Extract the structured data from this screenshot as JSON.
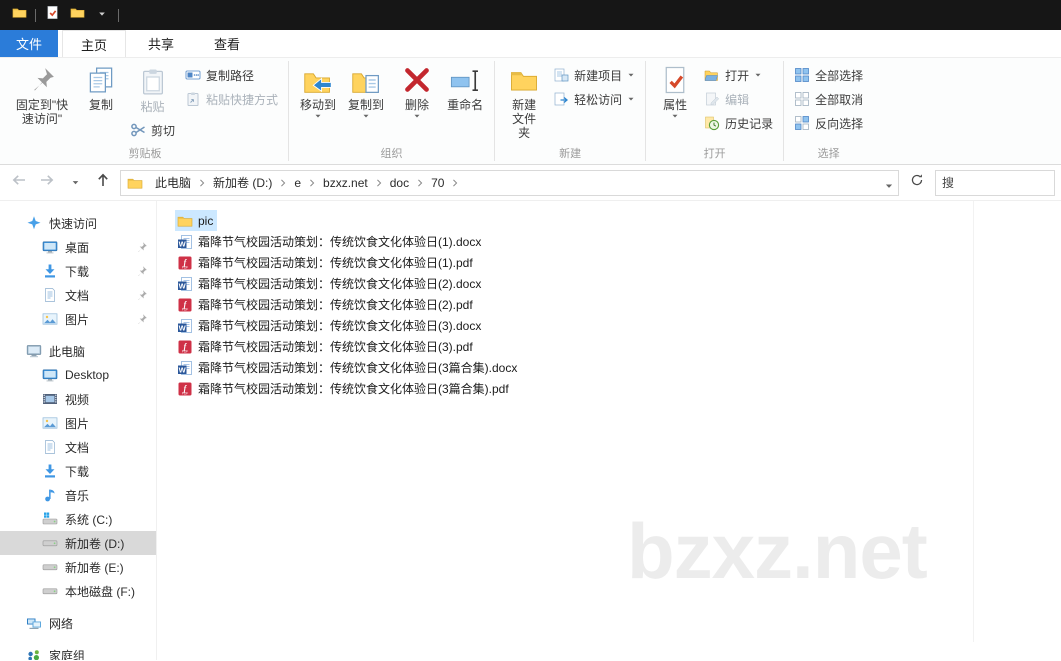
{
  "titlebar": {
    "qat": [
      {
        "icon": "folder"
      },
      {
        "icon": "check-doc"
      },
      {
        "icon": "folder"
      }
    ]
  },
  "tabs": {
    "file": "文件",
    "items": [
      "主页",
      "共享",
      "查看"
    ],
    "active": "主页"
  },
  "ribbon": {
    "clipboard": {
      "pin": "固定到\"快速访问\"",
      "copy": "复制",
      "paste": "粘贴",
      "cut": "剪切",
      "copy_path": "复制路径",
      "paste_shortcut": "粘贴快捷方式",
      "label": "剪贴板"
    },
    "organize": {
      "move_to": "移动到",
      "copy_to": "复制到",
      "delete": "删除",
      "rename": "重命名",
      "label": "组织"
    },
    "new": {
      "new_folder": "新建文件夹",
      "new_item": "新建项目",
      "easy_access": "轻松访问",
      "label": "新建"
    },
    "open": {
      "properties": "属性",
      "open": "打开",
      "edit": "编辑",
      "history": "历史记录",
      "label": "打开"
    },
    "select": {
      "select_all": "全部选择",
      "select_none": "全部取消",
      "invert": "反向选择",
      "label": "选择"
    }
  },
  "addressbar": {
    "breadcrumb": [
      "此电脑",
      "新加卷 (D:)",
      "e",
      "bzxz.net",
      "doc",
      "70"
    ],
    "search_text": "搜"
  },
  "sidebar": {
    "sections": [
      {
        "label": "快速访问",
        "icon": "star",
        "items": [
          {
            "label": "桌面",
            "icon": "desktop",
            "pinned": true
          },
          {
            "label": "下载",
            "icon": "download",
            "pinned": true
          },
          {
            "label": "文档",
            "icon": "document",
            "pinned": true
          },
          {
            "label": "图片",
            "icon": "picture",
            "pinned": true
          }
        ]
      },
      {
        "label": "此电脑",
        "icon": "computer",
        "gap": true,
        "items": [
          {
            "label": "Desktop",
            "icon": "desktop"
          },
          {
            "label": "视频",
            "icon": "video"
          },
          {
            "label": "图片",
            "icon": "picture"
          },
          {
            "label": "文档",
            "icon": "document"
          },
          {
            "label": "下载",
            "icon": "download"
          },
          {
            "label": "音乐",
            "icon": "music"
          },
          {
            "label": "系统 (C:)",
            "icon": "drive-sys"
          },
          {
            "label": "新加卷 (D:)",
            "icon": "drive",
            "selected": true
          },
          {
            "label": "新加卷 (E:)",
            "icon": "drive"
          },
          {
            "label": "本地磁盘 (F:)",
            "icon": "drive"
          }
        ]
      },
      {
        "label": "网络",
        "icon": "network",
        "gap": true,
        "items": []
      },
      {
        "label": "家庭组",
        "icon": "homegroup",
        "gap": true,
        "items": []
      }
    ]
  },
  "files": [
    {
      "name": "pic",
      "icon": "folder",
      "selected": true
    },
    {
      "name": "霜降节气校园活动策划：传统饮食文化体验日(1).docx",
      "icon": "word"
    },
    {
      "name": "霜降节气校园活动策划：传统饮食文化体验日(1).pdf",
      "icon": "pdf"
    },
    {
      "name": "霜降节气校园活动策划：传统饮食文化体验日(2).docx",
      "icon": "word"
    },
    {
      "name": "霜降节气校园活动策划：传统饮食文化体验日(2).pdf",
      "icon": "pdf"
    },
    {
      "name": "霜降节气校园活动策划：传统饮食文化体验日(3).docx",
      "icon": "word"
    },
    {
      "name": "霜降节气校园活动策划：传统饮食文化体验日(3).pdf",
      "icon": "pdf"
    },
    {
      "name": "霜降节气校园活动策划：传统饮食文化体验日(3篇合集).docx",
      "icon": "word"
    },
    {
      "name": "霜降节气校园活动策划：传统饮食文化体验日(3篇合集).pdf",
      "icon": "pdf"
    }
  ],
  "watermark": "bzxz.net"
}
